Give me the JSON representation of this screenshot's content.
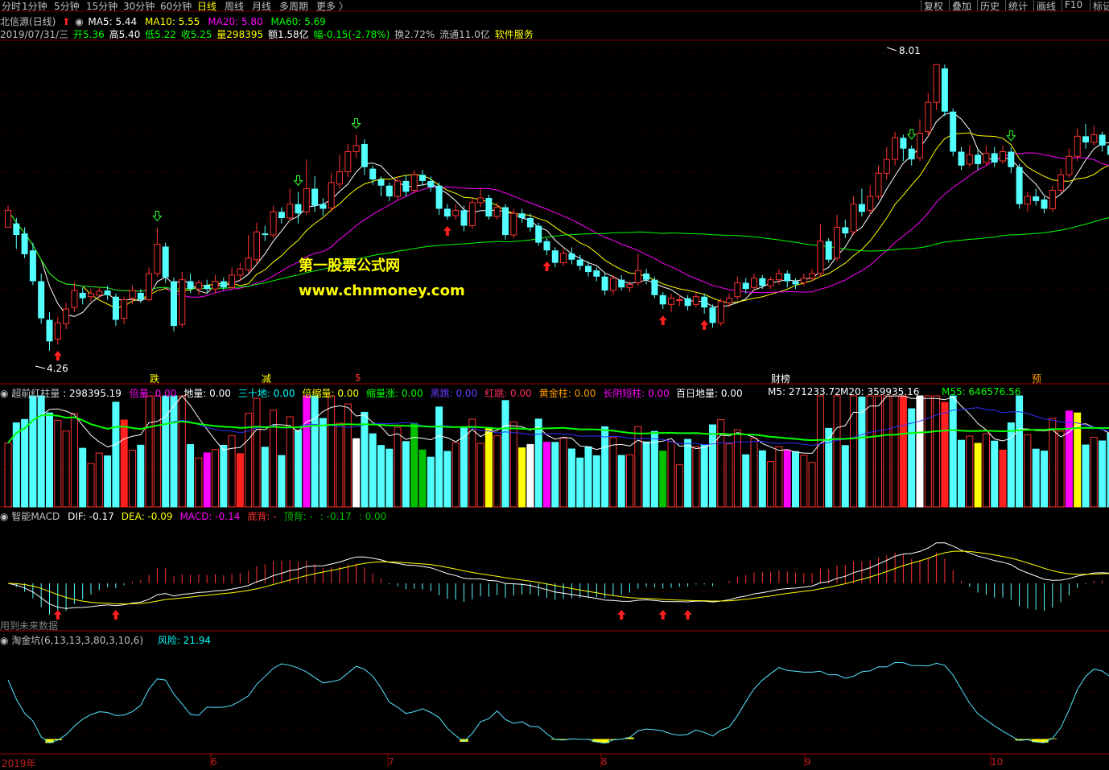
{
  "toolbar": {
    "periods": [
      "分时",
      "1分钟",
      "5分钟",
      "15分钟",
      "30分钟",
      "60分钟",
      "日线",
      "周线",
      "月线",
      "多周期",
      "更多 〉"
    ],
    "active_period": "日线",
    "right_buttons": [
      "复权",
      "叠加",
      "历史",
      "统计",
      "画线",
      "F10",
      "标记"
    ]
  },
  "main_title": {
    "stock": "北信源(日线)",
    "ma5": "MA5: 5.44",
    "ma10": "MA10: 5.55",
    "ma20": "MA20: 5.80",
    "ma60": "MA60: 5.69"
  },
  "quote": {
    "date": "2019/07/31/三",
    "open": "开5.36",
    "high": "高5.40",
    "low": "低5.22",
    "close": "收5.25",
    "vol": "量298395",
    "amount": "额1.58亿",
    "change": "幅-0.15(-2.78%)",
    "turnover": "换2.72%",
    "float": "流通11.0亿",
    "industry": "软件服务"
  },
  "price_labels": {
    "high": "8.01",
    "low": "4.26"
  },
  "watermark": {
    "line1": "第一股票公式网",
    "line2": "www.chnmoney.com"
  },
  "event_labels": [
    {
      "text": "跌",
      "color": "#ffff00",
      "x": 186
    },
    {
      "text": "减",
      "color": "#ffff00",
      "x": 325
    },
    {
      "text": "$",
      "color": "#ff3030",
      "x": 441
    },
    {
      "text": "财榜",
      "color": "#ffffff",
      "x": 958
    },
    {
      "text": "预",
      "color": "#ff9900",
      "x": 1282
    }
  ],
  "vol_panel": {
    "title": "超前红柱量",
    "value": ": 298395.19",
    "items": [
      {
        "label": "倍量: 0.00",
        "color": "#ff00ff"
      },
      {
        "label": "地量: 0.00",
        "color": "#ffffff"
      },
      {
        "label": "三十地: 0.00",
        "color": "#00ffff"
      },
      {
        "label": "倍缩量: 0.00",
        "color": "#ffff00"
      },
      {
        "label": "缩量涨: 0.00",
        "color": "#00ff00"
      },
      {
        "label": "黑跳: 0.00",
        "color": "#6a3cff"
      },
      {
        "label": "红跳: 0.00",
        "color": "#ff3060"
      },
      {
        "label": "黄金柱: 0.00",
        "color": "#ff9900"
      },
      {
        "label": "长阴短柱: 0.00",
        "color": "#ff00ff"
      }
    ],
    "extra": [
      {
        "label": "百日地量: 0.00",
        "color": "#ffffff"
      },
      {
        "label": "M5: 271233.72",
        "color": "#ffffff"
      },
      {
        "label": "M20: 359935.16",
        "color": "#ffffff"
      },
      {
        "label": "M55: 646576.56",
        "color": "#00ff00"
      }
    ]
  },
  "macd_panel": {
    "title": "智能MACD",
    "items": [
      {
        "label": "DIF: -0.17",
        "color": "#ffffff"
      },
      {
        "label": "DEA: -0.09",
        "color": "#ffff00"
      },
      {
        "label": "MACD: -0.14",
        "color": "#ff00ff"
      },
      {
        "label": "底背: -",
        "color": "#ff3030"
      },
      {
        "label": "顶背: -",
        "color": "#00c000"
      },
      {
        "label": ": -0.17",
        "color": "#00c000"
      },
      {
        "label": ": 0.00",
        "color": "#00c000"
      }
    ],
    "note": "用到未来数据"
  },
  "pit_panel": {
    "title": "淘金坑(6,13,13,3,80,3,10,6)",
    "risk": "风险: 21.94"
  },
  "month_axis": [
    {
      "label": "2019年",
      "x": 2
    },
    {
      "label": "6",
      "x": 262
    },
    {
      "label": "7",
      "x": 482
    },
    {
      "label": "8",
      "x": 747
    },
    {
      "label": "9",
      "x": 1000
    },
    {
      "label": "10",
      "x": 1231
    }
  ],
  "colors": {
    "up": "#ff3232",
    "down": "#54ffff",
    "ma5": "#ffffff",
    "ma10": "#ffff00",
    "ma20": "#ff00ff",
    "ma60": "#00ff00"
  },
  "chart_data": {
    "type": "candlestick",
    "ylim": [
      4.1,
      8.2
    ],
    "candles": [
      [
        5.9,
        6.12,
        6.18,
        5.95
      ],
      [
        5.95,
        5.8,
        6.02,
        5.62
      ],
      [
        5.82,
        5.55,
        5.9,
        5.5
      ],
      [
        5.6,
        5.2,
        5.7,
        5.15
      ],
      [
        5.2,
        4.72,
        5.3,
        4.65
      ],
      [
        4.7,
        4.42,
        4.8,
        4.3
      ],
      [
        4.45,
        4.66,
        4.74,
        4.38
      ],
      [
        4.65,
        4.84,
        4.92,
        4.58
      ],
      [
        4.86,
        5.08,
        5.18,
        4.8
      ],
      [
        5.05,
        4.98,
        5.12,
        4.9
      ],
      [
        5.0,
        5.04,
        5.1,
        4.94
      ],
      [
        5.02,
        5.07,
        5.12,
        4.98
      ],
      [
        5.08,
        5.02,
        5.14,
        4.96
      ],
      [
        5.0,
        4.7,
        5.04,
        4.62
      ],
      [
        4.72,
        4.96,
        5.0,
        4.64
      ],
      [
        4.98,
        5.08,
        5.14,
        4.9
      ],
      [
        5.05,
        4.96,
        5.1,
        4.92
      ],
      [
        4.96,
        5.3,
        5.38,
        4.94
      ],
      [
        5.3,
        5.68,
        5.9,
        5.26
      ],
      [
        5.65,
        5.25,
        5.7,
        5.18
      ],
      [
        5.2,
        4.62,
        5.25,
        4.55
      ],
      [
        4.64,
        5.22,
        5.32,
        4.6
      ],
      [
        5.2,
        5.1,
        5.3,
        5.05
      ],
      [
        5.1,
        5.18,
        5.22,
        5.02
      ],
      [
        5.15,
        5.1,
        5.22,
        5.06
      ],
      [
        5.1,
        5.2,
        5.28,
        5.05
      ],
      [
        5.2,
        5.12,
        5.25,
        5.08
      ],
      [
        5.12,
        5.28,
        5.38,
        5.1
      ],
      [
        5.28,
        5.36,
        5.44,
        5.2
      ],
      [
        5.35,
        5.5,
        5.8,
        5.3
      ],
      [
        5.48,
        5.84,
        5.96,
        5.42
      ],
      [
        5.82,
        5.8,
        5.92,
        5.72
      ],
      [
        5.8,
        6.1,
        6.18,
        5.76
      ],
      [
        6.1,
        6.02,
        6.16,
        5.95
      ],
      [
        6.02,
        6.2,
        6.4,
        5.98
      ],
      [
        6.2,
        6.08,
        6.36,
        5.95
      ],
      [
        6.1,
        6.4,
        6.78,
        6.06
      ],
      [
        6.4,
        6.18,
        6.56,
        6.1
      ],
      [
        6.2,
        6.14,
        6.28,
        6.05
      ],
      [
        6.15,
        6.48,
        6.6,
        6.1
      ],
      [
        6.46,
        6.62,
        6.84,
        6.4
      ],
      [
        6.62,
        6.88,
        6.98,
        6.55
      ],
      [
        6.88,
        6.96,
        7.1,
        6.8
      ],
      [
        6.98,
        6.68,
        7.04,
        6.58
      ],
      [
        6.66,
        6.52,
        6.7,
        6.45
      ],
      [
        6.52,
        6.44,
        6.56,
        6.3
      ],
      [
        6.44,
        6.3,
        6.48,
        6.24
      ],
      [
        6.3,
        6.5,
        6.56,
        6.26
      ],
      [
        6.5,
        6.36,
        6.58,
        6.3
      ],
      [
        6.38,
        6.58,
        6.64,
        6.34
      ],
      [
        6.58,
        6.5,
        6.64,
        6.44
      ],
      [
        6.5,
        6.42,
        6.56,
        6.36
      ],
      [
        6.44,
        6.14,
        6.48,
        6.06
      ],
      [
        6.14,
        6.04,
        6.2,
        6.0
      ],
      [
        6.05,
        6.12,
        6.2,
        6.0
      ],
      [
        6.12,
        5.92,
        6.18,
        5.85
      ],
      [
        5.92,
        6.22,
        6.28,
        5.88
      ],
      [
        6.22,
        6.28,
        6.4,
        6.16
      ],
      [
        6.28,
        6.04,
        6.32,
        6.0
      ],
      [
        6.04,
        6.16,
        6.22,
        6.0
      ],
      [
        6.16,
        5.8,
        6.2,
        5.74
      ],
      [
        5.8,
        6.08,
        6.14,
        5.76
      ],
      [
        6.08,
        6.02,
        6.14,
        5.96
      ],
      [
        6.02,
        5.9,
        6.08,
        5.84
      ],
      [
        5.92,
        5.7,
        5.96,
        5.66
      ],
      [
        5.72,
        5.6,
        5.76,
        5.54
      ],
      [
        5.6,
        5.44,
        5.64,
        5.38
      ],
      [
        5.44,
        5.56,
        5.62,
        5.4
      ],
      [
        5.56,
        5.48,
        5.64,
        5.42
      ],
      [
        5.48,
        5.4,
        5.54,
        5.34
      ],
      [
        5.4,
        5.32,
        5.46,
        5.26
      ],
      [
        5.34,
        5.26,
        5.38,
        5.2
      ],
      [
        5.26,
        5.08,
        5.3,
        5.02
      ],
      [
        5.08,
        5.24,
        5.28,
        5.02
      ],
      [
        5.22,
        5.12,
        5.28,
        5.08
      ],
      [
        5.12,
        5.16,
        5.2,
        5.06
      ],
      [
        5.18,
        5.34,
        5.56,
        5.14
      ],
      [
        5.3,
        5.22,
        5.36,
        5.16
      ],
      [
        5.22,
        5.02,
        5.26,
        4.98
      ],
      [
        5.02,
        4.9,
        5.06,
        4.84
      ],
      [
        4.9,
        4.98,
        5.04,
        4.8
      ],
      [
        4.96,
        4.96,
        5.02,
        4.88
      ],
      [
        4.98,
        4.88,
        5.02,
        4.82
      ],
      [
        4.9,
        5.0,
        5.06,
        4.86
      ],
      [
        5.0,
        4.86,
        5.04,
        4.78
      ],
      [
        4.86,
        4.66,
        4.9,
        4.6
      ],
      [
        4.66,
        4.94,
        4.98,
        4.62
      ],
      [
        4.92,
        4.98,
        5.04,
        4.86
      ],
      [
        5.0,
        5.18,
        5.26,
        4.96
      ],
      [
        5.18,
        5.1,
        5.24,
        5.04
      ],
      [
        5.12,
        5.24,
        5.3,
        5.08
      ],
      [
        5.24,
        5.14,
        5.28,
        5.1
      ],
      [
        5.14,
        5.22,
        5.26,
        5.1
      ],
      [
        5.22,
        5.3,
        5.36,
        5.16
      ],
      [
        5.3,
        5.2,
        5.34,
        5.12
      ],
      [
        5.2,
        5.16,
        5.24,
        5.1
      ],
      [
        5.18,
        5.24,
        5.3,
        5.14
      ],
      [
        5.24,
        5.3,
        5.36,
        5.2
      ],
      [
        5.3,
        5.72,
        5.94,
        5.26
      ],
      [
        5.72,
        5.48,
        5.76,
        5.44
      ],
      [
        5.5,
        5.9,
        6.06,
        5.46
      ],
      [
        5.9,
        5.82,
        6.0,
        5.76
      ],
      [
        5.84,
        6.2,
        6.3,
        5.8
      ],
      [
        6.2,
        6.1,
        6.4,
        6.04
      ],
      [
        6.12,
        6.3,
        6.44,
        6.06
      ],
      [
        6.3,
        6.6,
        6.7,
        6.26
      ],
      [
        6.6,
        6.78,
        6.94,
        6.52
      ],
      [
        6.78,
        7.06,
        7.14,
        6.7
      ],
      [
        7.06,
        6.92,
        7.1,
        6.76
      ],
      [
        6.92,
        6.78,
        6.96,
        6.7
      ],
      [
        6.8,
        7.12,
        7.3,
        6.76
      ],
      [
        7.14,
        7.52,
        7.64,
        7.08
      ],
      [
        7.52,
        8.01,
        8.01,
        7.42
      ],
      [
        7.96,
        7.4,
        8.01,
        7.34
      ],
      [
        7.4,
        6.88,
        7.44,
        6.82
      ],
      [
        6.88,
        6.7,
        6.94,
        6.64
      ],
      [
        6.72,
        6.84,
        6.96,
        6.68
      ],
      [
        6.84,
        6.72,
        6.92,
        6.64
      ],
      [
        6.74,
        6.86,
        6.96,
        6.7
      ],
      [
        6.86,
        6.74,
        6.94,
        6.68
      ],
      [
        6.76,
        6.88,
        6.96,
        6.72
      ],
      [
        6.88,
        6.68,
        6.94,
        6.6
      ],
      [
        6.68,
        6.2,
        6.72,
        6.14
      ],
      [
        6.2,
        6.3,
        6.36,
        6.1
      ],
      [
        6.3,
        6.24,
        6.4,
        6.18
      ],
      [
        6.26,
        6.14,
        6.3,
        6.08
      ],
      [
        6.14,
        6.38,
        6.44,
        6.1
      ],
      [
        6.38,
        6.58,
        6.66,
        6.34
      ],
      [
        6.58,
        6.82,
        6.92,
        6.54
      ],
      [
        6.82,
        7.08,
        7.18,
        6.76
      ],
      [
        7.08,
        7.0,
        7.24,
        6.92
      ],
      [
        7.0,
        7.1,
        7.22,
        6.96
      ],
      [
        7.1,
        6.96,
        7.14,
        6.88
      ],
      [
        6.96,
        6.84,
        7.02,
        6.78
      ],
      [
        6.84,
        6.92,
        6.98,
        6.8
      ],
      [
        6.92,
        7.12,
        7.18,
        6.88
      ],
      [
        7.12,
        7.32,
        7.48,
        7.08
      ],
      [
        7.32,
        7.26,
        7.52,
        7.2
      ]
    ]
  }
}
